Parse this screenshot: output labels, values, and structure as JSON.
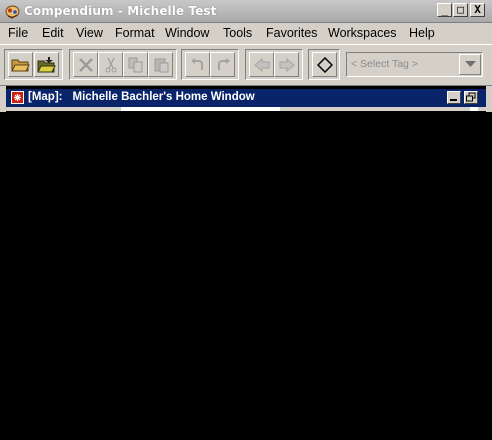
{
  "window": {
    "title": "Compendium - Michelle Test",
    "controls": [
      "_",
      "□",
      "X"
    ]
  },
  "menubar": {
    "items": [
      {
        "label": "File"
      },
      {
        "label": "Edit"
      },
      {
        "label": "View"
      },
      {
        "label": "Format"
      },
      {
        "label": "Window"
      },
      {
        "label": "Tools"
      },
      {
        "label": "Favorites"
      },
      {
        "label": "Workspaces"
      },
      {
        "label": "Help"
      }
    ]
  },
  "toolbar": {
    "buttons": [
      {
        "icon": "open-folder-icon",
        "enabled": true
      },
      {
        "icon": "open-map-folder-icon",
        "enabled": true
      },
      {
        "icon": "delete-icon",
        "enabled": false
      },
      {
        "icon": "cut-icon",
        "enabled": false
      },
      {
        "icon": "copy-icon",
        "enabled": false
      },
      {
        "icon": "paste-icon",
        "enabled": false
      },
      {
        "icon": "undo-icon",
        "enabled": false
      },
      {
        "icon": "redo-icon",
        "enabled": false
      },
      {
        "icon": "back-icon",
        "enabled": false
      },
      {
        "icon": "forward-icon",
        "enabled": false
      },
      {
        "icon": "diamond-icon",
        "enabled": true
      }
    ],
    "tag_select": {
      "value": "< Select Tag >"
    }
  },
  "inner_window": {
    "type_label": "[Map]:",
    "title": "Michelle Bachler's Home Window"
  },
  "colors": {
    "titlebar": "#a9a9a9",
    "inner_titlebar": "#0a246a",
    "chrome": "#d4d0c8",
    "background": "#000000"
  }
}
